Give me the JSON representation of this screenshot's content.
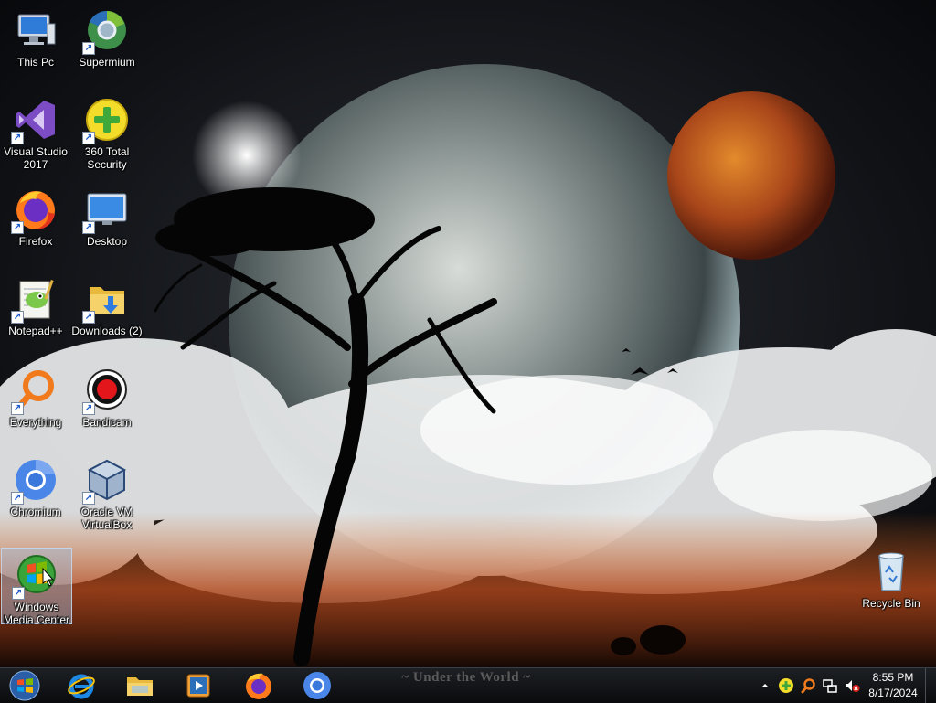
{
  "desktop": {
    "icons": [
      {
        "label": "This Pc"
      },
      {
        "label": "Supermium"
      },
      {
        "label": "Visual Studio 2017"
      },
      {
        "label": "360 Total Security"
      },
      {
        "label": "Firefox"
      },
      {
        "label": "Desktop"
      },
      {
        "label": "Notepad++"
      },
      {
        "label": "Downloads (2)"
      },
      {
        "label": "Everything"
      },
      {
        "label": "Bandicam"
      },
      {
        "label": "Chromium"
      },
      {
        "label": "Oracle VM VirtualBox"
      },
      {
        "label": "Windows Media Center"
      },
      {
        "label": "Recycle Bin"
      }
    ],
    "wallpaper_text": "~ Under the World ~"
  },
  "taskbar": {
    "pinned": [
      "start-orb",
      "internet-explorer-icon",
      "file-explorer-icon",
      "media-player-icon",
      "firefox-icon",
      "chromium-icon"
    ],
    "tray": {
      "time": "8:55 PM",
      "date": "8/17/2024",
      "volume_muted": true
    }
  },
  "colors": {
    "taskbar": "#0f1114",
    "selection": "#a0bee1"
  }
}
